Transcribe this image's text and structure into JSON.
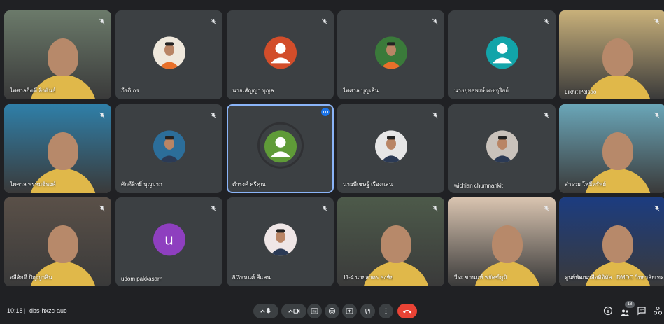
{
  "meeting": {
    "time": "10:18",
    "separator": "|",
    "code": "dbs-hxzc-auc",
    "participant_count": "18"
  },
  "participants": [
    {
      "name": "ไพศาลกิตติ์ ลิงพันธ์",
      "kind": "video",
      "bg": "#6b7a6a"
    },
    {
      "name": "กีรติ กร",
      "kind": "photo",
      "bg": "#efe8dc"
    },
    {
      "name": "นายเสัญญา บุญล",
      "kind": "default",
      "bg": "#d24d2a"
    },
    {
      "name": "ไพศาล บุญเส้น",
      "kind": "photo",
      "bg": "#3a7a3a"
    },
    {
      "name": "นายยุทธพงษ์ เดชจุริยย์",
      "kind": "default",
      "bg": "#12a4a9"
    },
    {
      "name": "Likhit Polsao",
      "kind": "video",
      "bg": "#c8b07a"
    },
    {
      "name": "ไพศาล พรหมชิพงศ์",
      "kind": "video",
      "bg": "#2f7fa8"
    },
    {
      "name": "ศักดิ์สิทธิ์ บุญมาก",
      "kind": "photo",
      "bg": "#2c6e9a"
    },
    {
      "name": "ดำรงค์ ศรีคุณ",
      "kind": "default",
      "bg": "#5f9b38"
    },
    {
      "name": "นายพีเชษฐ์ เรืองแสน",
      "kind": "photo",
      "bg": "#e6e6e6"
    },
    {
      "name": "wichian chumnankit",
      "kind": "photo",
      "bg": "#c9c2bb"
    },
    {
      "name": "สำรวย โพธิ์ทรัพย์",
      "kind": "video",
      "bg": "#6aa6b8"
    },
    {
      "name": "อลีศักดิ์ ปิญญาสิน",
      "kind": "video",
      "bg": "#5a5048"
    },
    {
      "name": "udom pakkasarn",
      "kind": "letter",
      "letter": "u",
      "bg": "#8e3fbf"
    },
    {
      "name": "8/3พหนศ์ สีแสน",
      "kind": "photo",
      "bg": "#efe6e6"
    },
    {
      "name": "11-4 นายสาคร ธงชัย",
      "kind": "video",
      "bg": "#4d5a4a"
    },
    {
      "name": "วีระ ขานนท์ พยัคฆ์ภูมิ",
      "kind": "video",
      "bg": "#d9c4b0"
    },
    {
      "name": "ศูนย์พัฒนาสื่อดิจิทัล : DMDC วิทยาลัยเทคนิค...",
      "kind": "video",
      "bg": "#1c3c80"
    }
  ],
  "toolbar": {
    "chevron_label": "chevron-up",
    "end_call_color": "#ea4335"
  }
}
